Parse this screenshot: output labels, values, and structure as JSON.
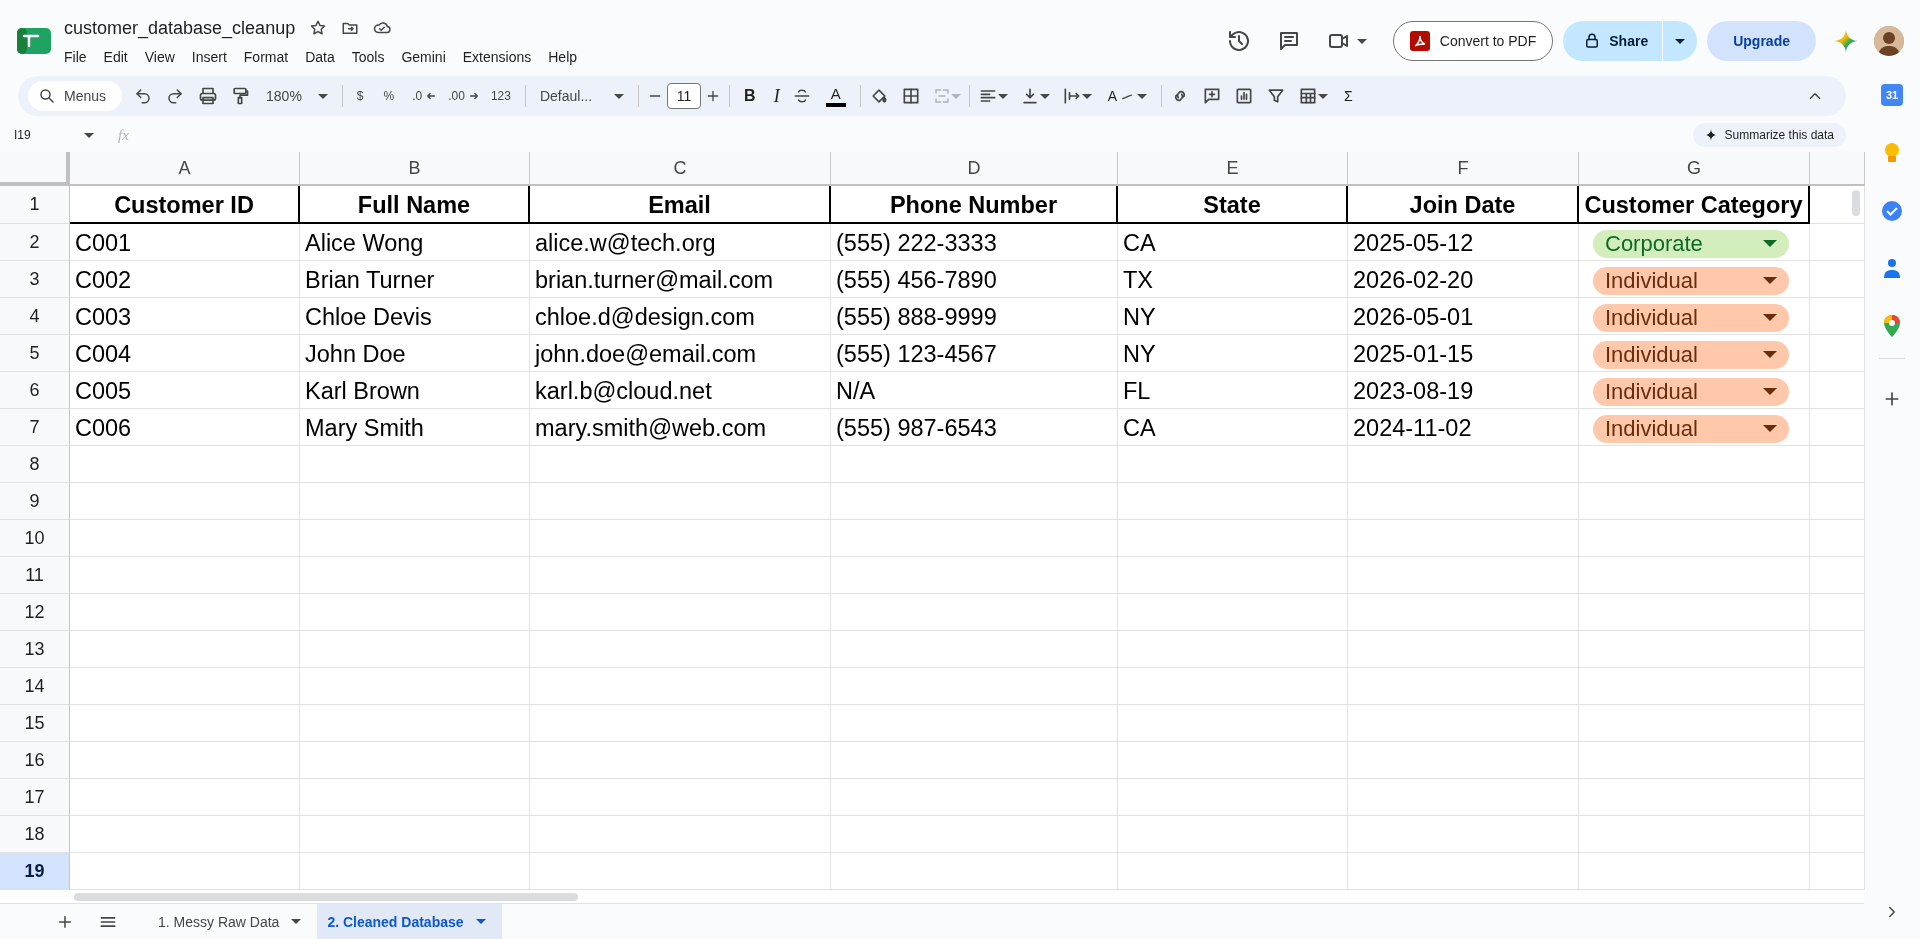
{
  "document": {
    "title": "customer_database_cleanup",
    "menus": [
      "File",
      "Edit",
      "View",
      "Insert",
      "Format",
      "Data",
      "Tools",
      "Gemini",
      "Extensions",
      "Help"
    ],
    "convert_button": "Convert to PDF",
    "share_button": "Share",
    "upgrade_button": "Upgrade"
  },
  "toolbar": {
    "search_placeholder": "Menus",
    "zoom": "180%",
    "currency": "$",
    "percent": "%",
    "decrease_decimals": ".0",
    "increase_decimals": ".00",
    "number_format": "123",
    "font": "Defaul...",
    "font_size": "11",
    "bold": "B",
    "italic": "I",
    "text_color": "A",
    "text_rotation": "A",
    "functions": "Σ"
  },
  "formula_bar": {
    "cell_name": "I19",
    "fx": "fx",
    "summarize_button": "Summarize this data"
  },
  "sheet": {
    "columns": [
      "A",
      "B",
      "C",
      "D",
      "E",
      "F",
      "G"
    ],
    "rows": [
      {
        "number": "1",
        "selected": false,
        "kind": "header",
        "cells": [
          "Customer ID",
          "Full Name",
          "Email",
          "Phone Number",
          "State",
          "Join Date",
          "Customer Category"
        ]
      },
      {
        "number": "2",
        "selected": false,
        "kind": "data",
        "cells": [
          "C001",
          "Alice Wong",
          "alice.w@tech.org",
          "(555) 222-3333",
          "CA",
          "2025-05-12"
        ],
        "category": {
          "label": "Corporate",
          "color": "#d4edbc"
        }
      },
      {
        "number": "3",
        "selected": false,
        "kind": "data",
        "cells": [
          "C002",
          "Brian Turner",
          "brian.turner@mail.com",
          "(555) 456-7890",
          "TX",
          "2026-02-20"
        ],
        "category": {
          "label": "Individual",
          "color": "#ffc8aa"
        }
      },
      {
        "number": "4",
        "selected": false,
        "kind": "data",
        "cells": [
          "C003",
          "Chloe Devis",
          "chloe.d@design.com",
          "(555) 888-9999",
          "NY",
          "2026-05-01"
        ],
        "category": {
          "label": "Individual",
          "color": "#ffc8aa"
        }
      },
      {
        "number": "5",
        "selected": false,
        "kind": "data",
        "cells": [
          "C004",
          "John Doe",
          "john.doe@email.com",
          "(555) 123-4567",
          "NY",
          "2025-01-15"
        ],
        "category": {
          "label": "Individual",
          "color": "#ffc8aa"
        }
      },
      {
        "number": "6",
        "selected": false,
        "kind": "data",
        "cells": [
          "C005",
          "Karl Brown",
          "karl.b@cloud.net",
          "N/A",
          "FL",
          "2023-08-19"
        ],
        "category": {
          "label": "Individual",
          "color": "#ffc8aa"
        }
      },
      {
        "number": "7",
        "selected": false,
        "kind": "data",
        "cells": [
          "C006",
          "Mary Smith",
          "mary.smith@web.com",
          "(555) 987-6543",
          "CA",
          "2024-11-02"
        ],
        "category": {
          "label": "Individual",
          "color": "#ffc8aa"
        }
      },
      {
        "number": "8",
        "selected": false,
        "kind": "empty"
      },
      {
        "number": "9",
        "selected": false,
        "kind": "empty"
      },
      {
        "number": "10",
        "selected": false,
        "kind": "empty"
      },
      {
        "number": "11",
        "selected": false,
        "kind": "empty"
      },
      {
        "number": "12",
        "selected": false,
        "kind": "empty"
      },
      {
        "number": "13",
        "selected": false,
        "kind": "empty"
      },
      {
        "number": "14",
        "selected": false,
        "kind": "empty"
      },
      {
        "number": "15",
        "selected": false,
        "kind": "empty"
      },
      {
        "number": "16",
        "selected": false,
        "kind": "empty"
      },
      {
        "number": "17",
        "selected": false,
        "kind": "empty"
      },
      {
        "number": "18",
        "selected": false,
        "kind": "empty"
      },
      {
        "number": "19",
        "selected": true,
        "kind": "empty"
      }
    ]
  },
  "sheet_tabs": [
    {
      "label": "1. Messy Raw Data",
      "selected": false
    },
    {
      "label": "2. Cleaned Database",
      "selected": true
    }
  ],
  "side_panel": {
    "calendar_day": "31"
  }
}
